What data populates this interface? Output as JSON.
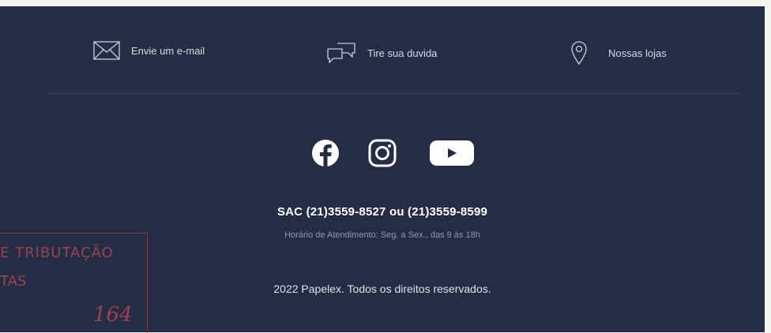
{
  "contact_links": [
    {
      "label": "Envie um e-mail",
      "icon": "envelope-icon"
    },
    {
      "label": "Tire sua duvida",
      "icon": "chat-bubbles-icon"
    },
    {
      "label": "Nossas lojas",
      "icon": "map-pin-icon"
    }
  ],
  "social": [
    {
      "name": "facebook-icon"
    },
    {
      "name": "instagram-icon"
    },
    {
      "name": "youtube-icon"
    }
  ],
  "sac_text": "SAC (21)3559-8527 ou (21)3559-8599",
  "hours_text": "Horário de Atendimento: Seg. a Sex., das 9 às 18h",
  "copyright_text": "2022 Papelex. Todos os direitos reservados.",
  "stamp": {
    "line1": "E TRIBUTAÇÃO",
    "line2": "TAS",
    "number": "164"
  },
  "colors": {
    "footer_bg": "#252d45",
    "text_muted": "#8d96b8",
    "stamp_red": "#c94c55"
  }
}
